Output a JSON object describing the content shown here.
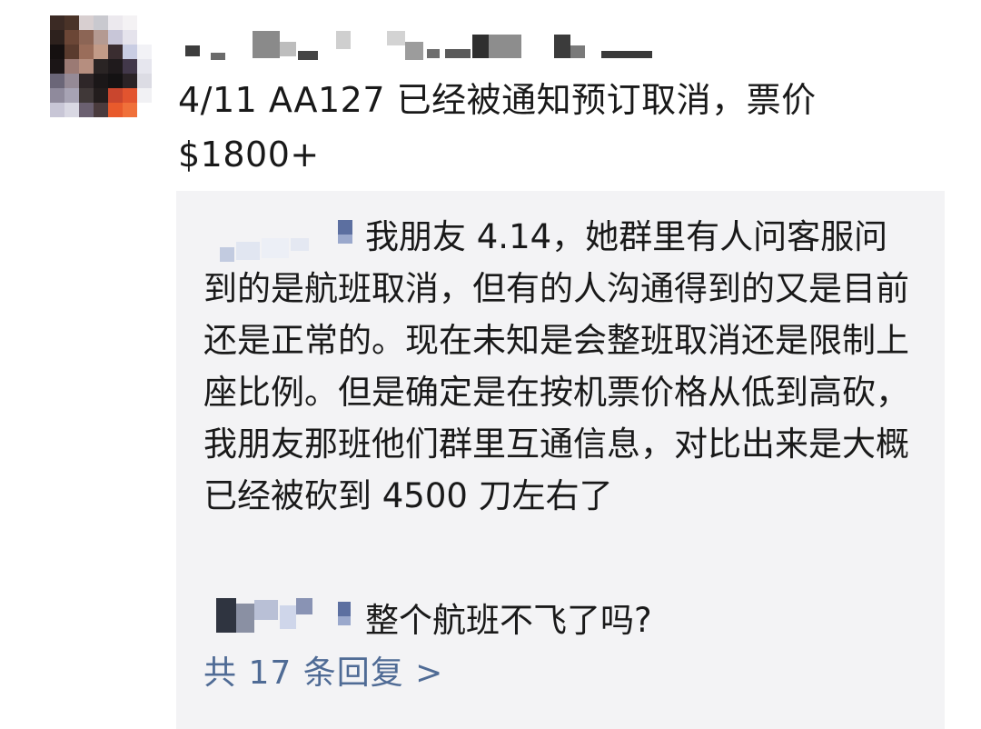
{
  "comment": {
    "text_line1": "4/11 AA127 已经被通知预订取消，票价",
    "text_line2": "$1800+"
  },
  "replies": [
    {
      "line1": "我朋友 4.14，她群里有人问客服问",
      "rest": "到的是航班取消，但有的人沟通得到的又是目前还是正常的。现在未知是会整班取消还是限制上座比例。但是确定是在按机票价格从低到高砍，我朋友那班他们群里互通信息，对比出来是大概已经被砍到 4500 刀左右了"
    },
    {
      "line1": "整个航班不飞了吗?"
    }
  ],
  "view_replies_label": "共 17 条回复 >",
  "colors": {
    "link": "#4f6b95",
    "reply_bg": "#f3f3f5",
    "text": "#191919"
  }
}
